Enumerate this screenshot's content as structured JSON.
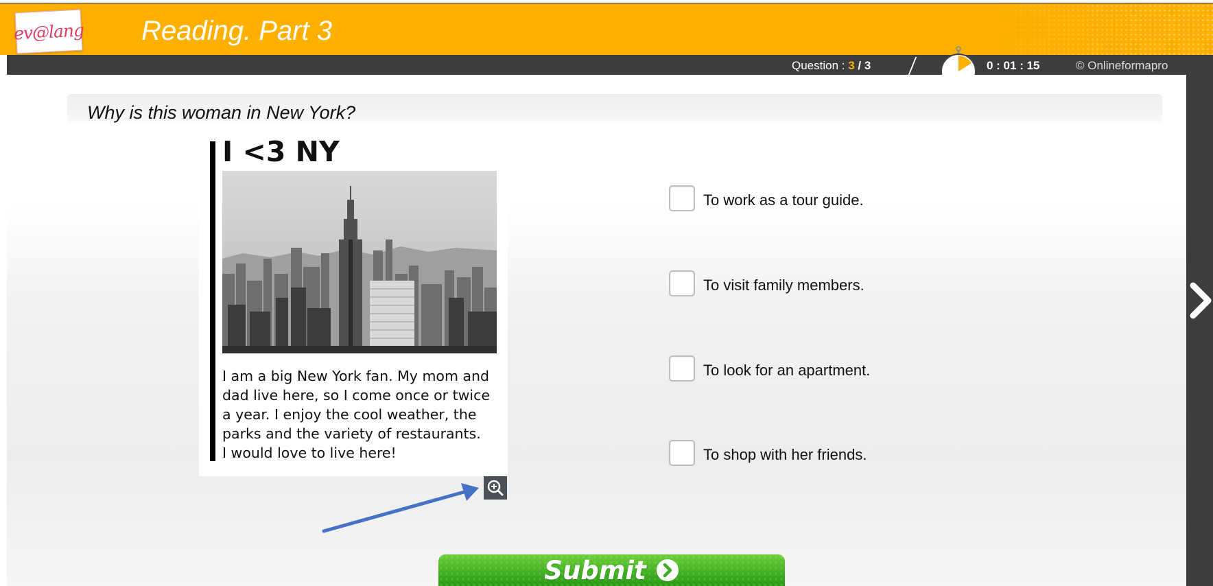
{
  "header": {
    "logo_text": "ev@lang",
    "title": "Reading. Part 3",
    "bg_color": "#fdb000"
  },
  "statusbar": {
    "question_prefix": "Question : ",
    "question_current": "3",
    "question_sep": " / ",
    "question_total": "3",
    "timer": "0 : 01 : 15",
    "copyright": "© Onlineformapro",
    "timer_icon": "stopwatch-icon"
  },
  "question": {
    "text": "Why is this woman in New York?"
  },
  "article": {
    "title": "I <3 NY",
    "body_lines": [
      "I am a big New York fan. My mom and",
      "dad live here, so I come once or twice",
      "a year. I enjoy the cool weather, the",
      "parks and the variety of restaurants.",
      "I would love to live here!"
    ],
    "photo": "new-york-skyline-photo",
    "zoom_icon": "zoom-in-icon"
  },
  "answers": [
    {
      "label": "To work as a tour guide.",
      "checked": false
    },
    {
      "label": "To visit family members.",
      "checked": false
    },
    {
      "label": "To look for an apartment.",
      "checked": false
    },
    {
      "label": "To shop with her friends.",
      "checked": false
    }
  ],
  "submit": {
    "label": "Submit",
    "icon": "chevron-circle-right-icon",
    "color": "#3fae22"
  },
  "navigation": {
    "next_icon": "chevron-right-icon"
  },
  "annotation": {
    "arrow_color": "#4472c4"
  }
}
